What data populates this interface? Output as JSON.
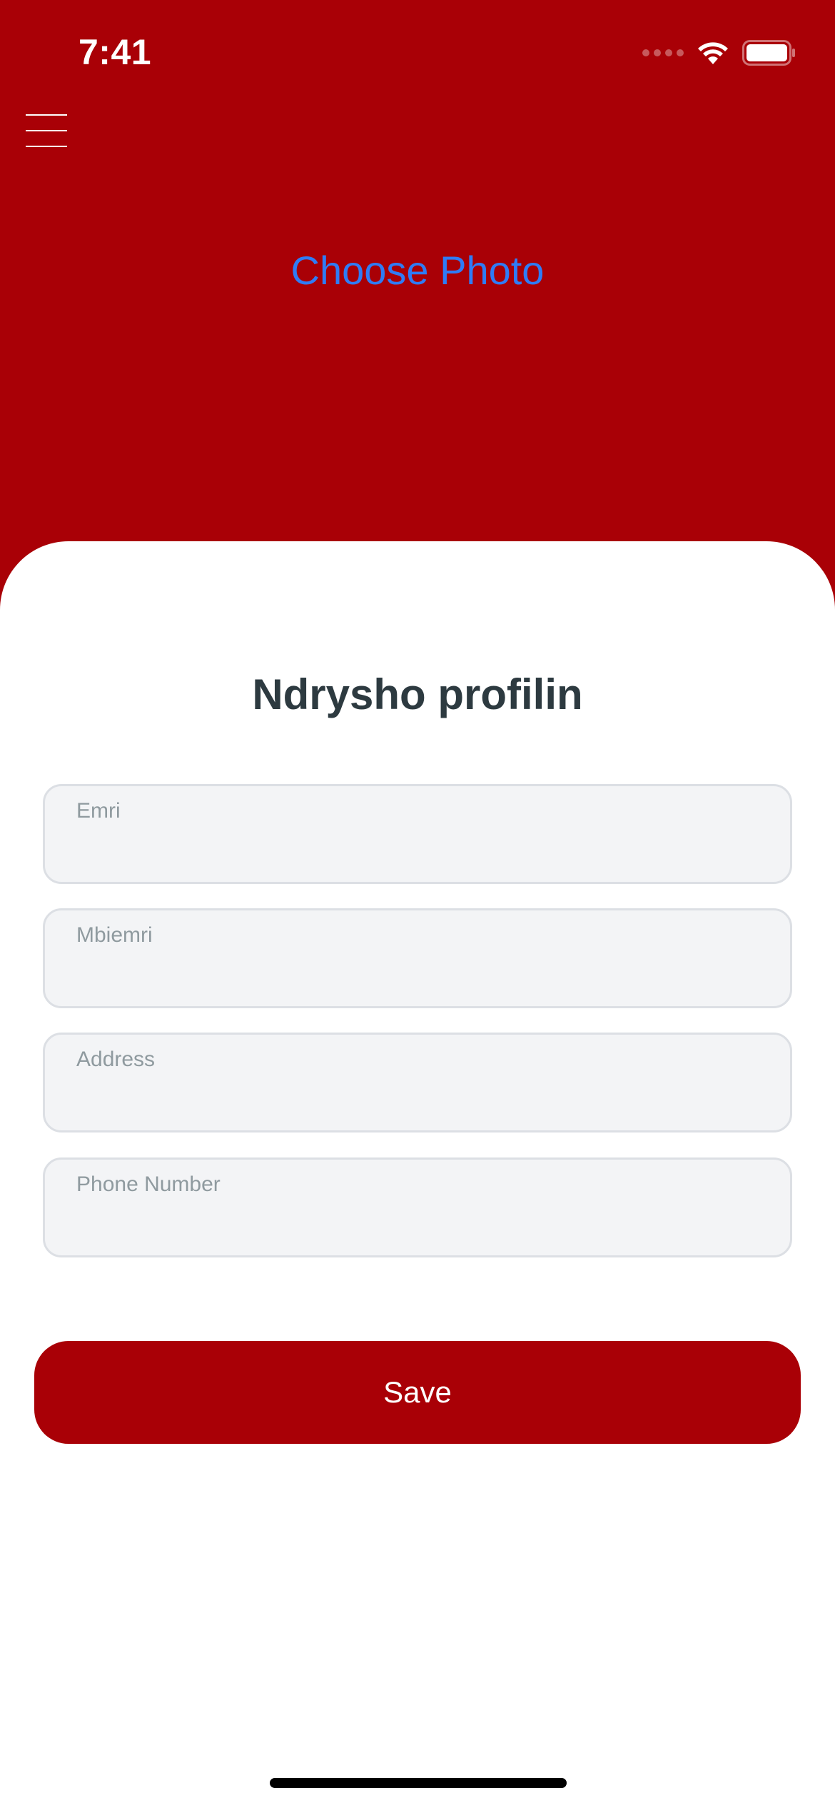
{
  "status_bar": {
    "time": "7:41",
    "icons": [
      "cellular-signal-icon",
      "wifi-icon",
      "battery-icon"
    ]
  },
  "header": {
    "menu_icon": "hamburger-menu-icon",
    "choose_photo": "Choose Photo"
  },
  "form": {
    "title": "Ndrysho profilin",
    "fields": [
      {
        "label": "Emri",
        "value": ""
      },
      {
        "label": "Mbiemri",
        "value": ""
      },
      {
        "label": "Address",
        "value": ""
      },
      {
        "label": "Phone Number",
        "value": ""
      }
    ],
    "save_label": "Save"
  },
  "colors": {
    "brand_red": "#A90006",
    "link_blue": "#2F7CF6",
    "title_text": "#2D3A40",
    "field_bg": "#F3F4F6",
    "field_border": "#DCDFE4",
    "field_label": "#8F9A9F"
  }
}
